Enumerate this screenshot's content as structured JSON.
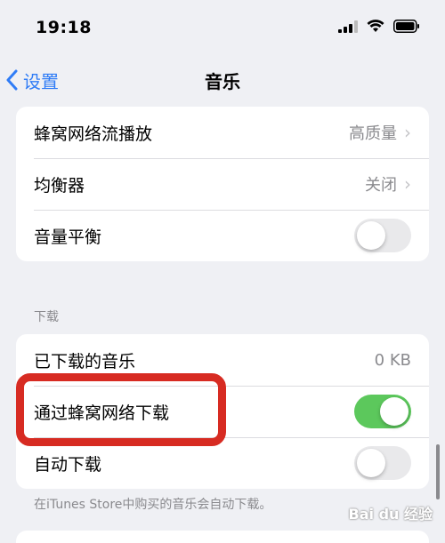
{
  "status_bar": {
    "time": "19:18",
    "icons": [
      "cellular-signal-icon",
      "wifi-icon",
      "battery-icon"
    ]
  },
  "nav": {
    "back_label": "设置",
    "title": "音乐"
  },
  "playback_group": {
    "rows": [
      {
        "label": "蜂窝网络流播放",
        "value": "高质量"
      },
      {
        "label": "均衡器",
        "value": "关闭"
      },
      {
        "label": "音量平衡",
        "toggle_on": false
      }
    ]
  },
  "downloads_group": {
    "header": "下载",
    "rows": [
      {
        "label": "已下载的音乐",
        "value": "0 KB"
      },
      {
        "label": "通过蜂窝网络下载",
        "toggle_on": true
      },
      {
        "label": "自动下载",
        "toggle_on": false
      }
    ],
    "footer": "在iTunes Store中购买的音乐会自动下载。"
  },
  "watermark": "Bai du 经验",
  "colors": {
    "accent": "#2f7cf6",
    "toggle_on": "#5cc85c",
    "highlight": "#d72b22",
    "background": "#eff0f4"
  }
}
